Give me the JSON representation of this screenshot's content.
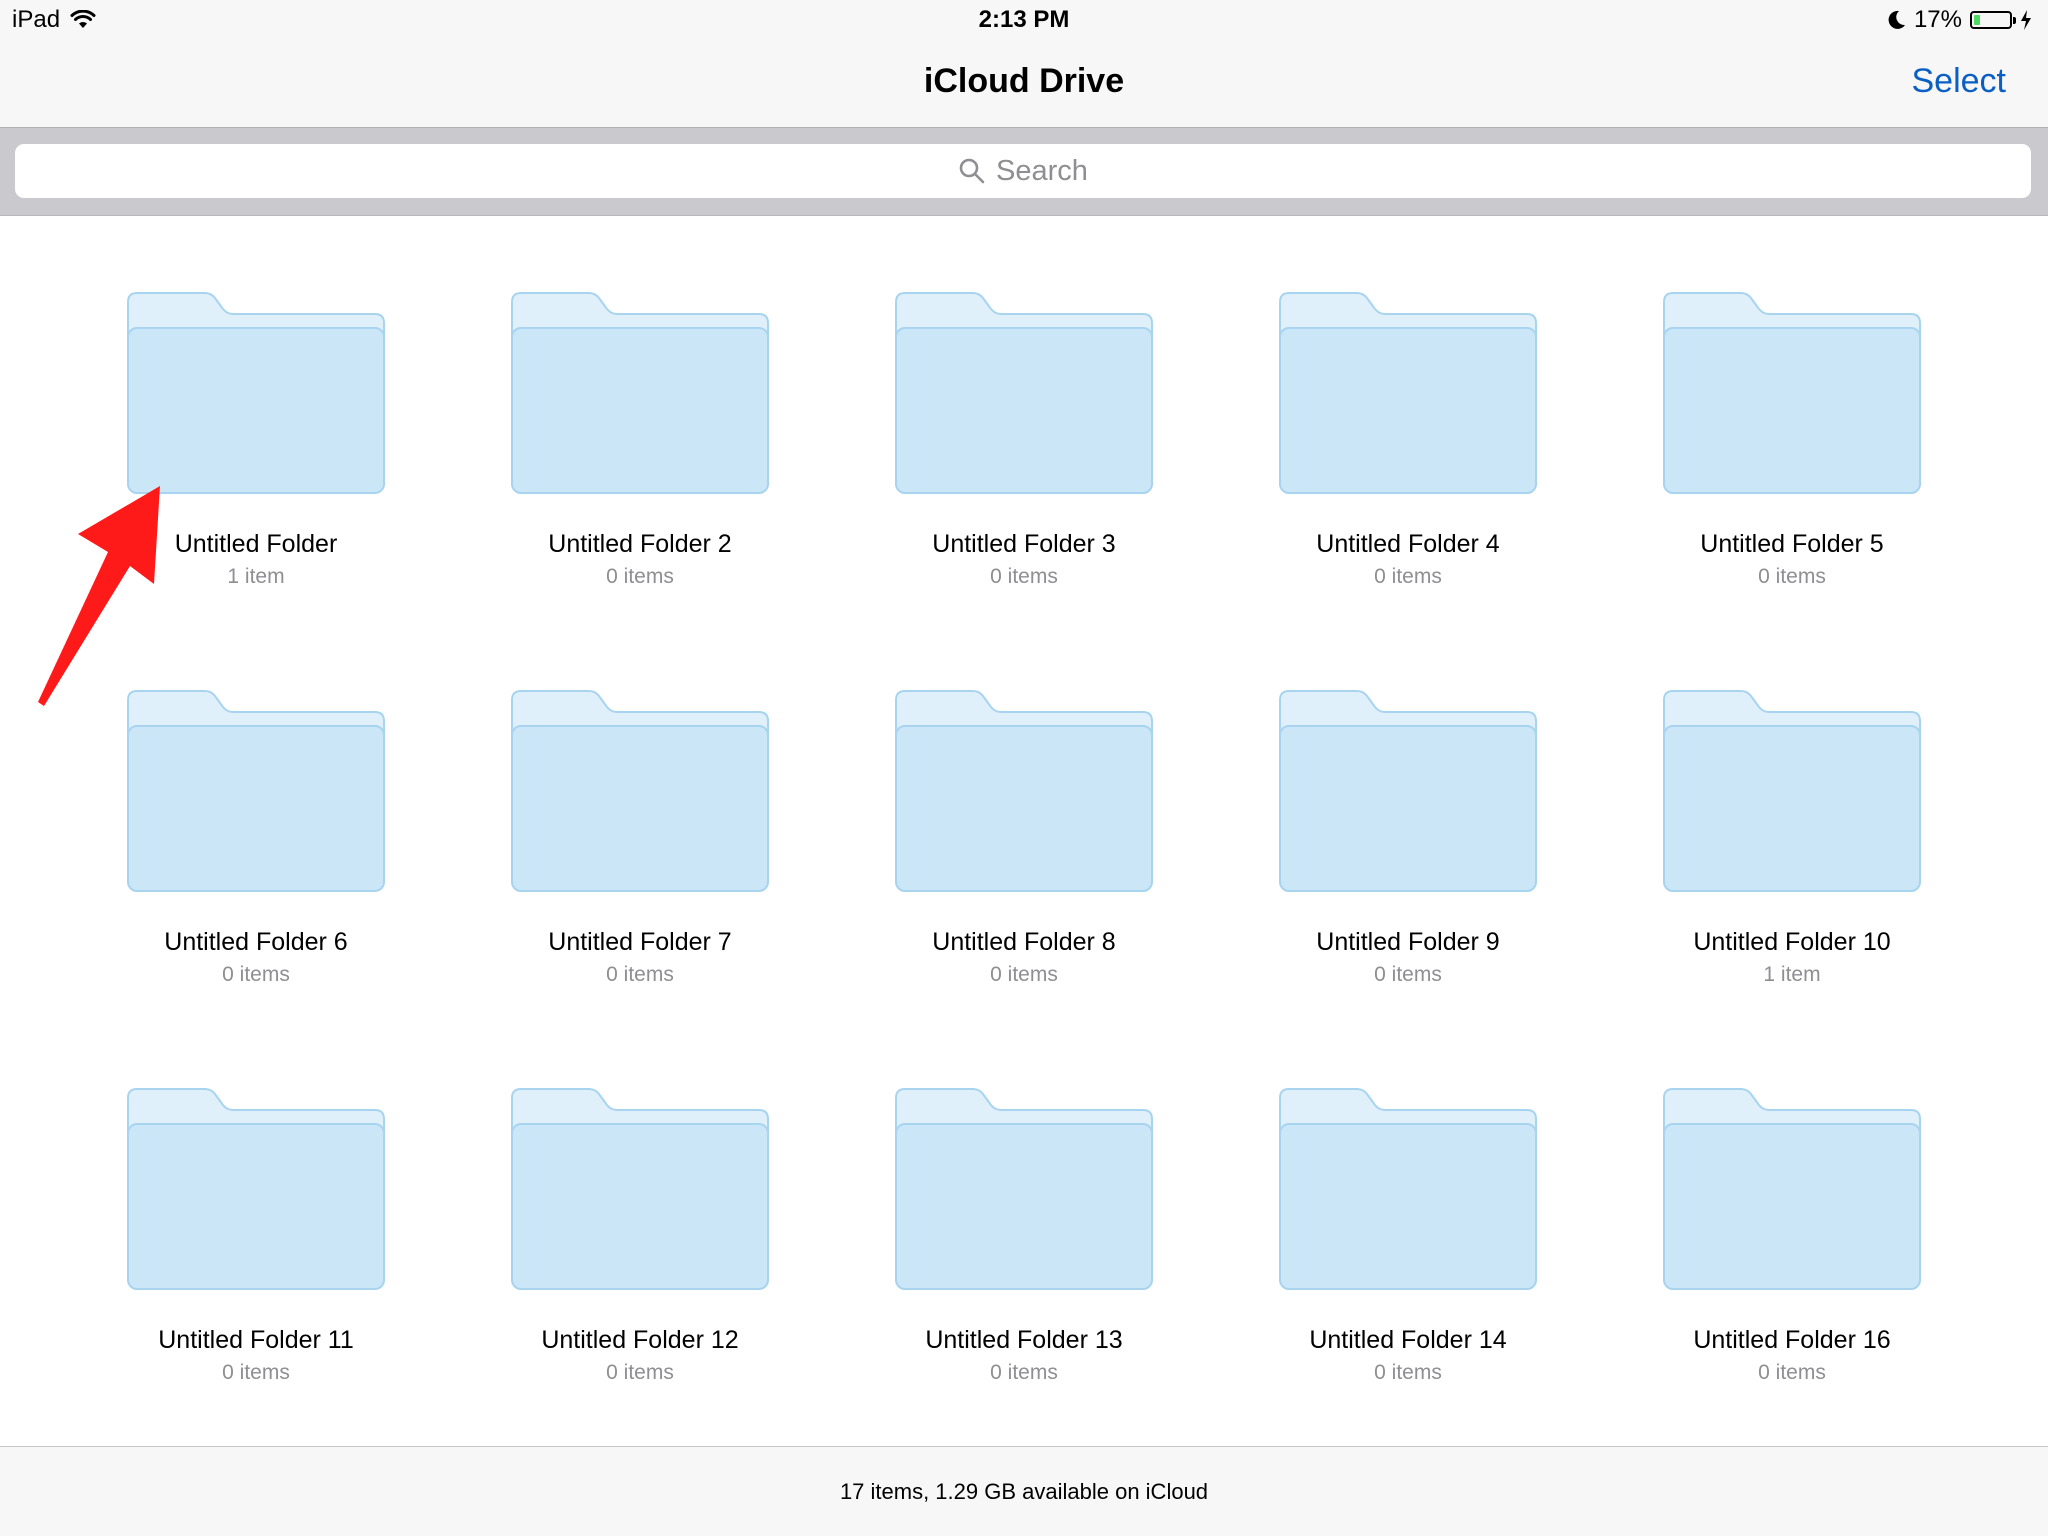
{
  "status_bar": {
    "device": "iPad",
    "time": "2:13 PM",
    "battery_percent": "17%",
    "battery_level": 0.17,
    "icons": [
      "wifi-icon",
      "moon-icon",
      "battery-icon",
      "charging-bolt-icon"
    ]
  },
  "nav": {
    "title": "iCloud Drive",
    "select_label": "Select"
  },
  "search": {
    "placeholder": "Search",
    "icon": "search-icon"
  },
  "folders": [
    {
      "name": "Untitled Folder",
      "count": "1 item"
    },
    {
      "name": "Untitled Folder 2",
      "count": "0 items"
    },
    {
      "name": "Untitled Folder 3",
      "count": "0 items"
    },
    {
      "name": "Untitled Folder 4",
      "count": "0 items"
    },
    {
      "name": "Untitled Folder 5",
      "count": "0 items"
    },
    {
      "name": "Untitled Folder 6",
      "count": "0 items"
    },
    {
      "name": "Untitled Folder 7",
      "count": "0 items"
    },
    {
      "name": "Untitled Folder 8",
      "count": "0 items"
    },
    {
      "name": "Untitled Folder 9",
      "count": "0 items"
    },
    {
      "name": "Untitled Folder 10",
      "count": "1 item"
    },
    {
      "name": "Untitled Folder 11",
      "count": "0 items"
    },
    {
      "name": "Untitled Folder 12",
      "count": "0 items"
    },
    {
      "name": "Untitled Folder 13",
      "count": "0 items"
    },
    {
      "name": "Untitled Folder 14",
      "count": "0 items"
    },
    {
      "name": "Untitled Folder 16",
      "count": "0 items"
    }
  ],
  "footer": {
    "summary": "17 items, 1.29 GB available on iCloud"
  },
  "colors": {
    "accent": "#0a5fc5",
    "folder_fill": "#cbe6f7",
    "folder_tab": "#dff0fb",
    "folder_stroke": "#a8d4ef",
    "annotation_arrow": "#ff1a1a",
    "battery_fill": "#4cd964"
  }
}
